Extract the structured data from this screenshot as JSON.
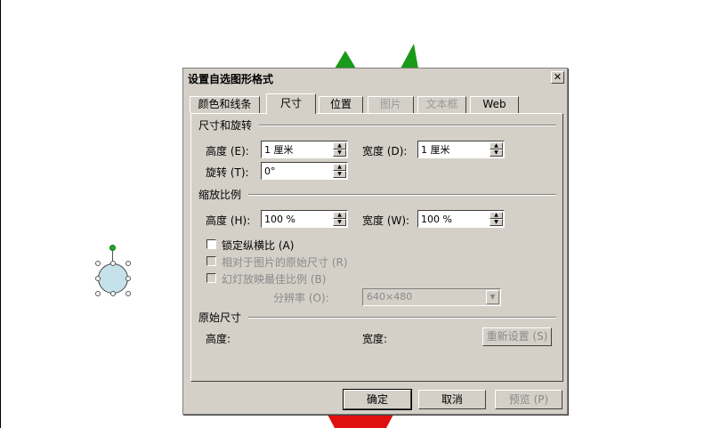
{
  "dialog": {
    "title": "设置自选图形格式",
    "close_label": "✕"
  },
  "tabs": [
    {
      "label": "颜色和线条"
    },
    {
      "label": "尺寸"
    },
    {
      "label": "位置"
    },
    {
      "label": "图片"
    },
    {
      "label": "文本框"
    },
    {
      "label": "Web"
    }
  ],
  "size_rotate": {
    "group_label": "尺寸和旋转",
    "height_label": "高度 (E):",
    "height_value": "1 厘米",
    "width_label": "宽度 (D):",
    "width_value": "1 厘米",
    "rotate_label": "旋转 (T):",
    "rotate_value": "0°"
  },
  "scale": {
    "group_label": "缩放比例",
    "height_label": "高度 (H):",
    "height_value": "100 %",
    "width_label": "宽度 (W):",
    "width_value": "100 %",
    "lock_aspect_label": "锁定纵横比 (A)",
    "relative_label": "相对于图片的原始尺寸 (R)",
    "best_scale_label": "幻灯放映最佳比例 (B)",
    "resolution_label": "分辨率 (O):",
    "resolution_value": "640×480"
  },
  "original": {
    "group_label": "原始尺寸",
    "height_label": "高度:",
    "width_label": "宽度:",
    "reset_label": "重新设置 (S)"
  },
  "footer": {
    "ok_label": "确定",
    "cancel_label": "取消",
    "preview_label": "预览 (P)"
  },
  "colors": {
    "green_shape": "#1a9a1a",
    "red_shape": "#e01010",
    "circle_fill": "#c5e1ea",
    "rotate_handle": "#22aa22"
  }
}
